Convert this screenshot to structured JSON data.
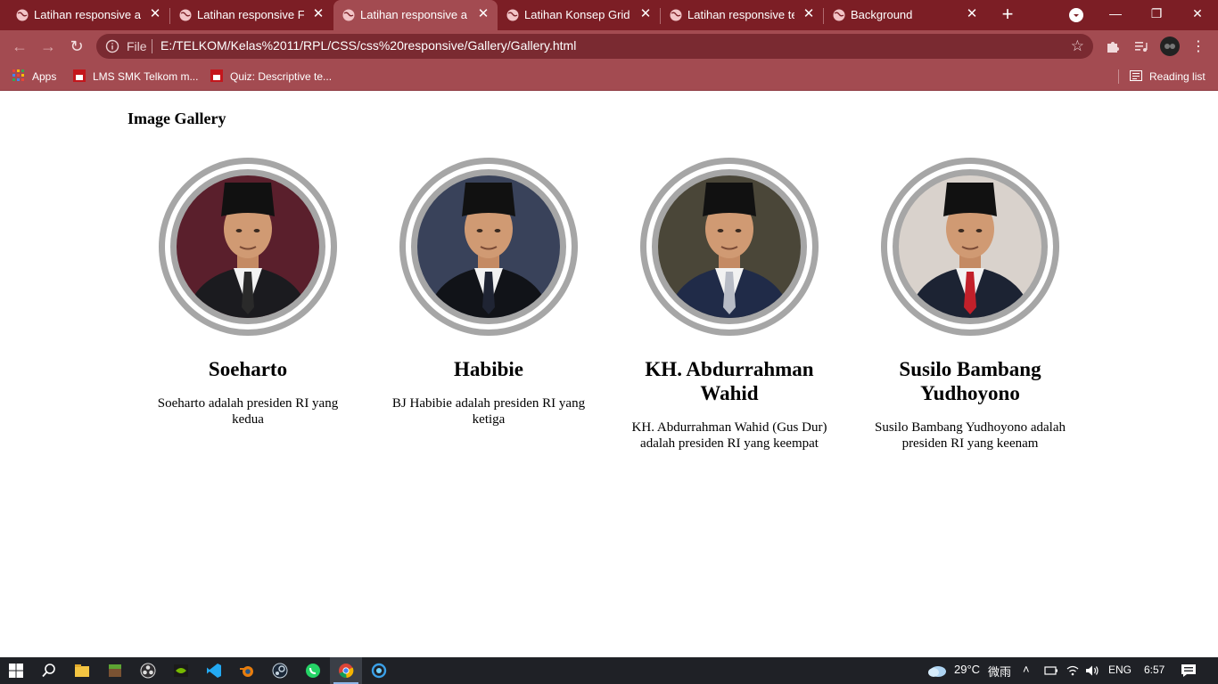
{
  "browser": {
    "tabs": [
      {
        "label": "Latihan responsive artikel",
        "active": false
      },
      {
        "label": "Latihan responsive Form",
        "active": false
      },
      {
        "label": "Latihan responsive artikel",
        "active": true
      },
      {
        "label": "Latihan Konsep Grid",
        "active": false
      },
      {
        "label": "Latihan responsive tentang",
        "active": false
      },
      {
        "label": "Background",
        "active": false
      }
    ],
    "new_tab_symbol": "+",
    "address": {
      "scheme_label": "File",
      "url": "E:/TELKOM/Kelas%2011/RPL/CSS/css%20responsive/Gallery/Gallery.html"
    },
    "bookmarks": {
      "apps": "Apps",
      "lms": "LMS SMK Telkom m...",
      "quiz": "Quiz: Descriptive te...",
      "reading_list": "Reading list"
    },
    "colors": {
      "frame": "#7c1e25",
      "toolbar": "#a34b51",
      "omnibox": "#7a2a31"
    }
  },
  "page": {
    "title": "Image Gallery",
    "gallery": [
      {
        "name": "Soeharto",
        "description": "Soeharto adalah presiden RI yang kedua",
        "bg": "#5a1f2c",
        "suit": "#1b1b1f",
        "tie": "#2a2a2a"
      },
      {
        "name": "Habibie",
        "description": "BJ Habibie adalah presiden RI yang ketiga",
        "bg": "#39425a",
        "suit": "#111318",
        "tie": "#1f2433"
      },
      {
        "name": "KH. Abdurrahman Wahid",
        "description": "KH. Abdurrahman Wahid (Gus Dur) adalah presiden RI yang keempat",
        "bg": "#4a4638",
        "suit": "#202b48",
        "tie": "#b8bcc6"
      },
      {
        "name": "Susilo Bambang Yudhoyono",
        "description": "Susilo Bambang Yudhoyono adalah presiden RI yang keenam",
        "bg": "#d9d2cc",
        "suit": "#1c2333",
        "tie": "#c2202a"
      }
    ]
  },
  "taskbar": {
    "weather": "29°C",
    "weather_text": "微雨",
    "language": "ENG",
    "time": "6:57"
  }
}
